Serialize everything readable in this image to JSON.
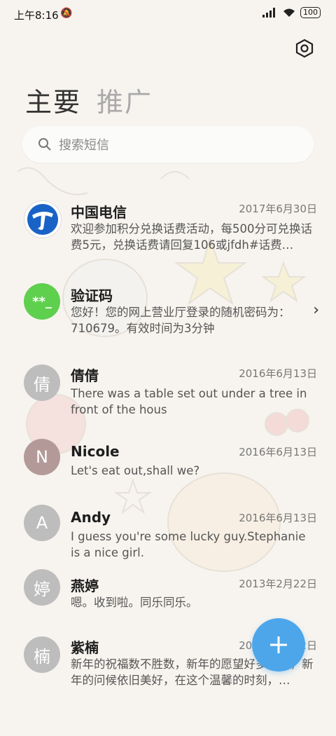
{
  "status_bar": {
    "time": "上午8:16",
    "battery": "100",
    "icons": [
      "mute-icon",
      "signal-icon",
      "wifi-icon",
      "battery-icon"
    ]
  },
  "header": {
    "settings_icon": "settings-hexagon-icon",
    "tabs": [
      {
        "label": "主要",
        "active": true
      },
      {
        "label": "推广",
        "active": false
      }
    ]
  },
  "search": {
    "placeholder": "搜索短信",
    "icon": "search-icon"
  },
  "messages": [
    {
      "avatar": "",
      "name": "中国电信",
      "date": "2017年6月30日",
      "preview": "欢迎参加积分兑换话费活动，每500分可兑换话费5元，兑换话费请回复106或jfdh#话费…",
      "avatar_color": "#ffffff"
    },
    {
      "avatar": "**_",
      "name": "验证码",
      "date": "",
      "preview": "您好！您的网上营业厅登录的随机密码为：710679。有效时间为3分钟",
      "avatar_color": "#5fcf4e"
    },
    {
      "avatar": "倩",
      "name": "倩倩",
      "date": "2016年6月13日",
      "preview": "There was a table set out under a tree in front of the hous",
      "avatar_color": "#bdbdbd"
    },
    {
      "avatar": "N",
      "name": "Nicole",
      "date": "2016年6月13日",
      "preview": "Let's eat out,shall we?",
      "avatar_color": "#b39a98"
    },
    {
      "avatar": "A",
      "name": "Andy",
      "date": "2016年6月13日",
      "preview": "I guess you're some lucky guy.Stephanie is a nice girl.",
      "avatar_color": "#bdbdbd"
    },
    {
      "avatar": "婷",
      "name": "燕婷",
      "date": "2013年2月22日",
      "preview": "嗯。收到啦。同乐同乐。",
      "avatar_color": "#bdbdbd"
    },
    {
      "avatar": "楠",
      "name": "紫楠",
      "date": "2013年2月22日",
      "preview": "新年的祝福数不胜数，新年的愿望好多好多，新年的问候依旧美好，在这个温馨的时刻，…",
      "avatar_color": "#bdbdbd"
    }
  ],
  "fab": {
    "label": "+",
    "icon": "compose-plus-icon",
    "color": "#4ea6ea"
  }
}
